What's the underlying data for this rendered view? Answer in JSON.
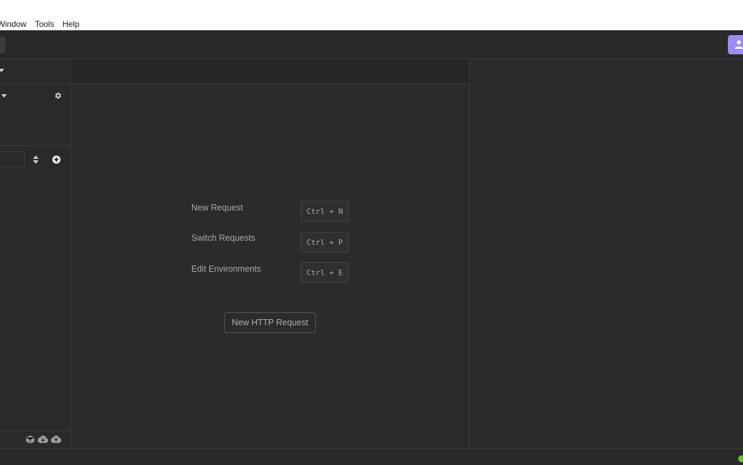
{
  "menubar": {
    "items": [
      "Window",
      "Tools",
      "Help"
    ]
  },
  "sidebar": {
    "filter": {
      "value": "",
      "placeholder": ""
    },
    "icons": {
      "settings": "gear-icon",
      "sort": "sort-icon",
      "add": "plus-circle-icon",
      "footer": [
        "box-icon",
        "cloud-download-icon",
        "cloud-upload-icon"
      ]
    }
  },
  "main": {
    "shortcuts": [
      {
        "label": "New Request",
        "keys": "Ctrl + N"
      },
      {
        "label": "Switch Requests",
        "keys": "Ctrl + P"
      },
      {
        "label": "Edit Environments",
        "keys": "Ctrl + E"
      }
    ],
    "new_http_request_label": "New HTTP Request"
  },
  "colors": {
    "accent": "#9b8cf2",
    "status_ok": "#70c030",
    "background": "#2a2a2a"
  }
}
